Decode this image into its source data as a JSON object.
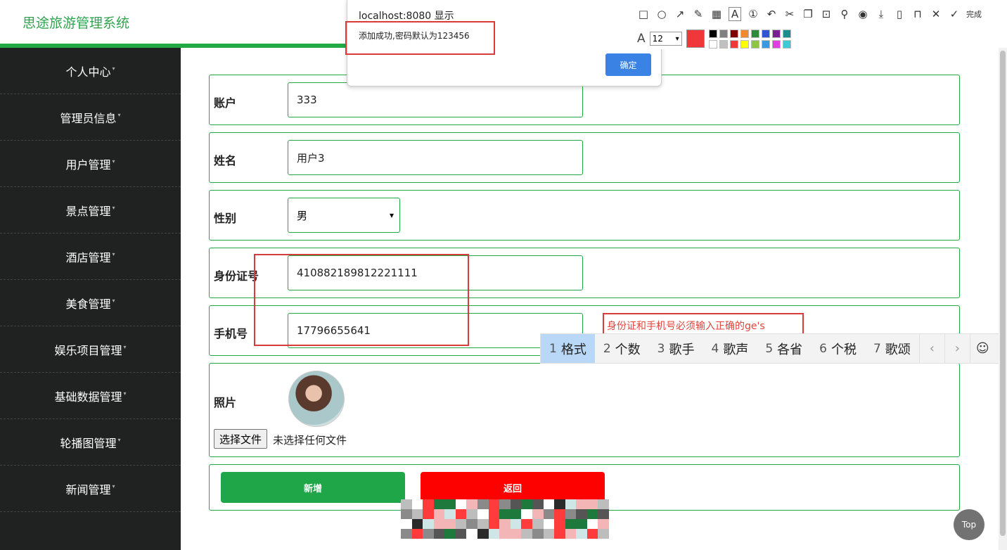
{
  "app": {
    "title": "思途旅游管理系统"
  },
  "sidebar": {
    "items": [
      {
        "label": "个人中心"
      },
      {
        "label": "管理员信息"
      },
      {
        "label": "用户管理"
      },
      {
        "label": "景点管理"
      },
      {
        "label": "酒店管理"
      },
      {
        "label": "美食管理"
      },
      {
        "label": "娱乐项目管理"
      },
      {
        "label": "基础数据管理"
      },
      {
        "label": "轮播图管理"
      },
      {
        "label": "新闻管理"
      }
    ]
  },
  "form": {
    "account": {
      "label": "账户",
      "value": "333"
    },
    "name": {
      "label": "姓名",
      "value": "用户3"
    },
    "gender": {
      "label": "性别",
      "value": "男"
    },
    "id_card": {
      "label": "身份证号",
      "value": "410882189812221111"
    },
    "phone": {
      "label": "手机号",
      "value": "17796655641"
    },
    "photo": {
      "label": "照片",
      "file_button": "选择文件",
      "file_status": "未选择任何文件"
    },
    "annotation": "身份证和手机号必须输入正确的ge's",
    "add_button": "新增",
    "back_button": "返回"
  },
  "alert": {
    "title": "localhost:8080 显示",
    "message": "添加成功,密码默认为123456",
    "ok_label": "确定"
  },
  "toolbar": {
    "done_label": "完成",
    "font_size": "12",
    "current_color": "#f0383a",
    "palette": [
      "#000000",
      "#808080",
      "#800000",
      "#f08a30",
      "#2e8b3a",
      "#2f55d4",
      "#7a1f8f",
      "#1b8f8f",
      "#ffffff",
      "#c0c0c0",
      "#f0383a",
      "#ffff00",
      "#8dc63f",
      "#3a9ae0",
      "#e040e0",
      "#40c8d8"
    ]
  },
  "ime": {
    "candidates": [
      {
        "num": "1",
        "text": "格式"
      },
      {
        "num": "2",
        "text": "个数"
      },
      {
        "num": "3",
        "text": "歌手"
      },
      {
        "num": "4",
        "text": "歌声"
      },
      {
        "num": "5",
        "text": "各省"
      },
      {
        "num": "6",
        "text": "个税"
      },
      {
        "num": "7",
        "text": "歌颂"
      }
    ],
    "prev": "‹",
    "next": "›",
    "emoji": "☺"
  },
  "back_to_top": "Top"
}
